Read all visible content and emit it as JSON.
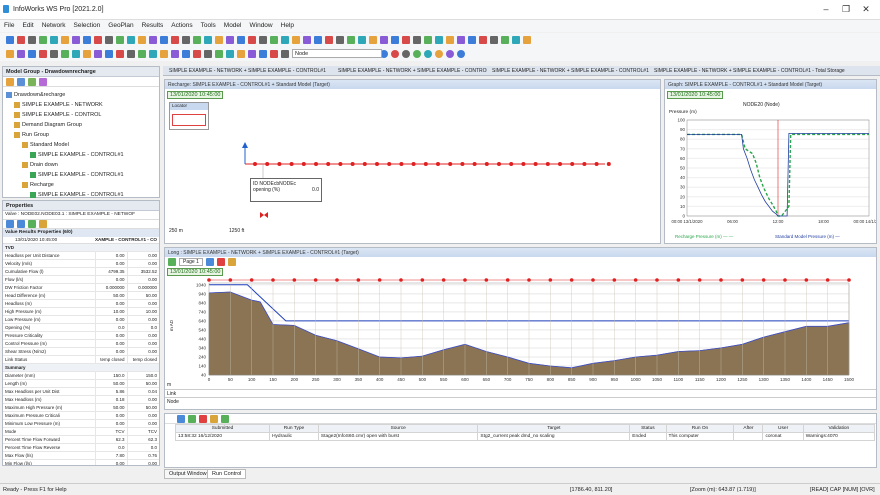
{
  "app": {
    "title": "InfoWorks WS Pro [2021.2.0]"
  },
  "menu": [
    "File",
    "Edit",
    "Network",
    "Selection",
    "GeoPlan",
    "Results",
    "Actions",
    "Tools",
    "Model",
    "Window",
    "Help"
  ],
  "toolbar": {
    "node_select": "Node"
  },
  "model_group": {
    "title": "Model Group - Drawdownrecharge",
    "tree": [
      {
        "label": "Drawdown&recharge",
        "indent": 0,
        "icon": "folder-icon"
      },
      {
        "label": "SIMPLE EXAMPLE - NETWORK",
        "indent": 1,
        "icon": "network-icon"
      },
      {
        "label": "SIMPLE EXAMPLE - CONTROL",
        "indent": 1,
        "icon": "control-icon"
      },
      {
        "label": "Demand Diagram Group",
        "indent": 1,
        "icon": "demand-icon"
      },
      {
        "label": "Run Group",
        "indent": 1,
        "icon": "rungroup-icon"
      },
      {
        "label": "Standard Model",
        "indent": 2,
        "icon": "run-icon"
      },
      {
        "label": "SIMPLE EXAMPLE - CONTROL#1",
        "indent": 3,
        "icon": "sim-icon"
      },
      {
        "label": "Drain down",
        "indent": 2,
        "icon": "run-icon"
      },
      {
        "label": "SIMPLE EXAMPLE - CONTROL#1",
        "indent": 3,
        "icon": "sim-icon"
      },
      {
        "label": "Recharge",
        "indent": 2,
        "icon": "run-icon"
      },
      {
        "label": "SIMPLE EXAMPLE - CONTROL#1",
        "indent": 3,
        "icon": "sim-icon"
      }
    ]
  },
  "properties": {
    "title": "Properties",
    "object": "Valve : NODE02.NODE03.1 : SIMPLE EXAMPLE - NETWOF",
    "header": "Value Results Properties (6/0)",
    "col_time": "13/01/2020 10:45:00",
    "col_run": "XAMPLE - CONTROL#1 - CO",
    "sections": [
      {
        "name": "TVD",
        "rows": [
          [
            "Headloss per Unit Distance",
            "0.00",
            "0.00"
          ],
          [
            "Velocity (m/s)",
            "0.00",
            "0.00"
          ],
          [
            "Cumulative Flow (l)",
            "4799.35",
            "3532.52"
          ],
          [
            "Flow (l/s)",
            "0.00",
            "0.00"
          ],
          [
            "DW Friction Factor",
            "0.000000",
            "0.000000"
          ],
          [
            "Head Difference (m)",
            "50.00",
            "50.00"
          ],
          [
            "Headloss (m)",
            "0.00",
            "0.00"
          ],
          [
            "High Pressure (m)",
            "10.00",
            "10.00"
          ],
          [
            "Low Pressure (m)",
            "0.00",
            "0.00"
          ],
          [
            "Opening (%)",
            "0.0",
            "0.0"
          ],
          [
            "Pressure Criticality",
            "0.00",
            "0.00"
          ],
          [
            "Control Pressure (m)",
            "0.00",
            "0.00"
          ],
          [
            "Shear Stress (N/m2)",
            "0.00",
            "0.00"
          ],
          [
            "Link Status",
            "temp closed",
            "temp closed"
          ]
        ]
      },
      {
        "name": "Summary",
        "rows": [
          [
            "Diameter (mm)",
            "150.0",
            "150.0"
          ],
          [
            "Length (m)",
            "50.00",
            "50.00"
          ],
          [
            "Max Headloss per Unit Dist",
            "5.86",
            "0.04"
          ],
          [
            "Max Headloss (m)",
            "0.18",
            "0.00"
          ],
          [
            "Maximum High Pressure (m)",
            "50.00",
            "50.00"
          ],
          [
            "Maximum Pressure Criticali",
            "0.00",
            "0.00"
          ],
          [
            "Minimum Low Pressure (m)",
            "0.00",
            "0.00"
          ],
          [
            "Mode",
            "TCV",
            "TCV"
          ],
          [
            "Percent Time Flow Forward",
            "62.3",
            "62.3"
          ],
          [
            "Percent Time Flow Reverse",
            "0.0",
            "0.0"
          ],
          [
            "Max Flow (l/s)",
            "7.80",
            "0.76"
          ],
          [
            "Min Flow (l/s)",
            "0.00",
            "0.00"
          ]
        ]
      }
    ]
  },
  "doc_tabs": [
    "SIMPLE EXAMPLE - NETWORK + SIMPLE EXAMPLE - CONTROL#1",
    "SIMPLE EXAMPLE - NETWORK + SIMPLE EXAMPLE - CONTROL#1",
    "SIMPLE EXAMPLE - NETWORK + SIMPLE EXAMPLE - CONTROL#1",
    "SIMPLE EXAMPLE - NETWORK + SIMPLE EXAMPLE - CONTROL#1 - Total Storage"
  ],
  "geoplan": {
    "title": "Recharge: SIMPLE EXAMPLE - CONTROL#1 + Standard Model (Target)",
    "time": "13/01/2020 10:45:00",
    "locator": "Locator",
    "tooltip": {
      "line1": "ID NODEcbNODEc",
      "line2": "opening (%)",
      "line2v": "0.0"
    },
    "scale1": "250 m",
    "scale2": "1250 ft"
  },
  "graph": {
    "title": "Graph: SIMPLE EXAMPLE - CONTROL#1 + Standard Model (Target)",
    "time": "13/01/2020 10:45:00",
    "heading": "NODE20 (Node)",
    "ylabel": "Pressure (m)",
    "legend1": "Recharge Pressure (m)",
    "legend2": "Standard Model Pressure (m)"
  },
  "long": {
    "title": "Long : SIMPLE EXAMPLE - NETWORK + SIMPLE EXAMPLE - CONTROL#1 (Target)",
    "time": "13/01/2020 10:45:00",
    "page": "Page 1",
    "row_m": "m",
    "row_link": "Link",
    "row_node": "Node",
    "ylabel": "m AD"
  },
  "runs": {
    "headers": [
      "Submitted",
      "Run Type",
      "Source",
      "Target",
      "Status",
      "Run On",
      "After",
      "User",
      "Validation"
    ],
    "row": [
      "13:58:32 16/12/2020",
      "Hydraulic",
      "Stage2(InfoS60.cmr) open with burst",
      "Stg2_current peak dmd_no scaling",
      "Ended",
      "This computer",
      "",
      "coronat",
      "Warnings:4070"
    ]
  },
  "bottom_tabs": [
    "Output Window",
    "Run Control"
  ],
  "status": {
    "left": "Ready - Press F1 for Help",
    "coords": "[1786.40, 811.20]",
    "zoom": "[Zoom (m): 643.87 (1.719)]",
    "right": "[READ] CAP [NUM] [OVR]"
  },
  "chart_data": [
    {
      "type": "line",
      "title": "NODE20 (Node)",
      "ylabel": "Pressure (m)",
      "x": [
        "00:00 13/1/2020",
        "06:00",
        "12:00",
        "18:00",
        "00:00 14/1/2020"
      ],
      "yticks": [
        0,
        10,
        20,
        30,
        40,
        50,
        60,
        70,
        80,
        90,
        100
      ],
      "ylim": [
        0,
        100
      ],
      "marker": "12:00",
      "series": [
        {
          "name": "Recharge Pressure (m)",
          "style": "dashed",
          "color": "#2aa64b",
          "points": [
            [
              0,
              85
            ],
            [
              0.3,
              85
            ],
            [
              0.32,
              70
            ],
            [
              0.36,
              65
            ],
            [
              0.38,
              55
            ],
            [
              0.4,
              40
            ],
            [
              0.42,
              30
            ],
            [
              0.45,
              18
            ],
            [
              0.47,
              12
            ],
            [
              0.49,
              5
            ],
            [
              0.5,
              0
            ],
            [
              0.52,
              0
            ],
            [
              0.56,
              10
            ],
            [
              0.57,
              85
            ],
            [
              1,
              85
            ]
          ]
        },
        {
          "name": "Standard Model Pressure (m)",
          "style": "solid",
          "color": "#223fa0",
          "points": [
            [
              0,
              85
            ],
            [
              0.3,
              85
            ],
            [
              0.31,
              70
            ],
            [
              0.33,
              60
            ],
            [
              0.35,
              48
            ],
            [
              0.37,
              38
            ],
            [
              0.39,
              30
            ],
            [
              0.41,
              22
            ],
            [
              0.43,
              15
            ],
            [
              0.45,
              10
            ],
            [
              0.47,
              5
            ],
            [
              0.49,
              2
            ],
            [
              0.5,
              0
            ],
            [
              0.55,
              0
            ],
            [
              0.56,
              86
            ],
            [
              1,
              86
            ]
          ]
        }
      ]
    },
    {
      "type": "area",
      "title": "Long section",
      "ylabel": "m AD",
      "yticks": [
        40,
        140,
        240,
        340,
        440,
        540,
        640,
        740,
        840,
        940,
        1040
      ],
      "ylim": [
        40,
        1060
      ],
      "x": [
        0,
        50,
        100,
        150,
        200,
        250,
        300,
        350,
        400,
        450,
        500,
        550,
        600,
        650,
        700,
        750,
        800,
        850,
        900,
        950,
        1000,
        1050,
        1100,
        1150,
        1200,
        1250,
        1300,
        1350,
        1400,
        1450,
        1500
      ],
      "ground_profile": [
        [
          0,
          950
        ],
        [
          50,
          960
        ],
        [
          100,
          870
        ],
        [
          120,
          850
        ],
        [
          150,
          600
        ],
        [
          200,
          590
        ],
        [
          250,
          480
        ],
        [
          300,
          420
        ],
        [
          350,
          330
        ],
        [
          400,
          240
        ],
        [
          450,
          230
        ],
        [
          500,
          250
        ],
        [
          550,
          320
        ],
        [
          600,
          380
        ],
        [
          650,
          300
        ],
        [
          700,
          240
        ],
        [
          750,
          170
        ],
        [
          800,
          140
        ],
        [
          850,
          120
        ],
        [
          900,
          170
        ],
        [
          950,
          200
        ],
        [
          1000,
          240
        ],
        [
          1050,
          260
        ],
        [
          1100,
          300
        ],
        [
          1150,
          310
        ],
        [
          1200,
          340
        ],
        [
          1250,
          380
        ],
        [
          1300,
          460
        ],
        [
          1350,
          520
        ],
        [
          1400,
          580
        ],
        [
          1450,
          580
        ],
        [
          1500,
          620
        ]
      ],
      "hgl": [
        [
          0,
          1040
        ],
        [
          90,
          1040
        ],
        [
          180,
          640
        ],
        [
          1500,
          640
        ]
      ]
    }
  ]
}
